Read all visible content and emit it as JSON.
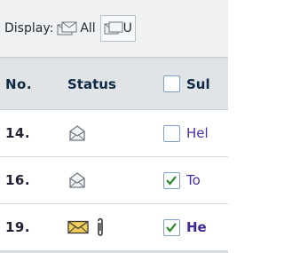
{
  "display_bar": {
    "label": "Display:",
    "all_label": "All",
    "unread_label": "U"
  },
  "table": {
    "headers": {
      "no": "No.",
      "status": "Status",
      "subject": "Sul"
    },
    "rows": [
      {
        "no": "14.",
        "status_icon": "read-envelope-icon",
        "checked": false,
        "subject": "Hel",
        "unread": false,
        "attachment": false
      },
      {
        "no": "16.",
        "status_icon": "read-envelope-icon",
        "checked": true,
        "subject": "To",
        "unread": false,
        "attachment": false
      },
      {
        "no": "19.",
        "status_icon": "unread-envelope-icon",
        "checked": true,
        "subject": "He",
        "unread": true,
        "attachment": true
      }
    ]
  },
  "colors": {
    "header_text": "#0f2a44",
    "link_text": "#4a2ea8",
    "checkbox_border": "#7da2c4",
    "checkmark": "#2f8a2f",
    "unread_envelope": "#f2cf5a"
  }
}
